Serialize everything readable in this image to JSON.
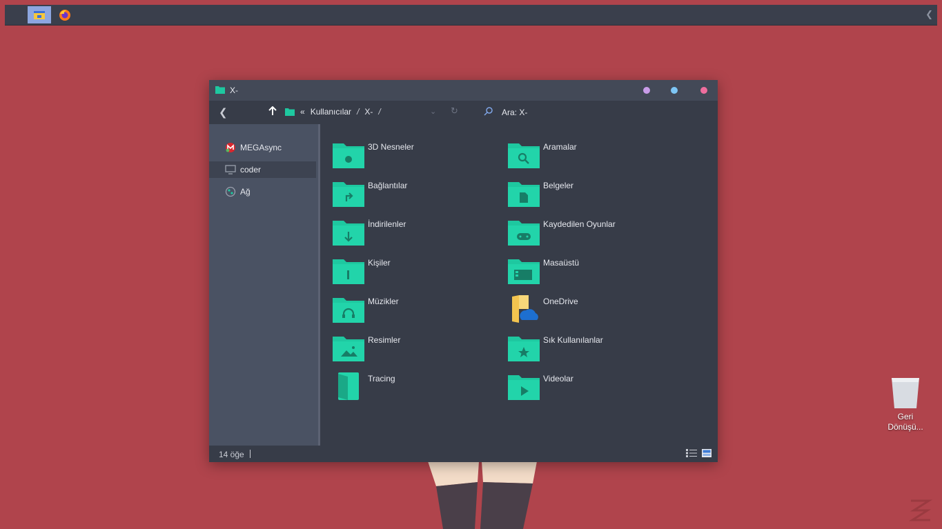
{
  "taskbar": {
    "apps": [
      {
        "name": "file-explorer",
        "icon": "folder-icon"
      },
      {
        "name": "firefox",
        "icon": "firefox-icon"
      }
    ],
    "overflow_icon": "chevron-left-icon"
  },
  "window": {
    "title": "X-",
    "controls": {
      "minimize": "#c99ce8",
      "maximize": "#7ec6f5",
      "close": "#ef6e9e"
    },
    "nav": {
      "back_icon": "chevron-left-icon",
      "up_icon": "arrow-up-icon",
      "breadcrumb_prefix": "«",
      "breadcrumbs": [
        "Kullanıcılar",
        "X-"
      ],
      "separator": "/",
      "search_placeholder": "Ara: X-"
    },
    "sidebar": {
      "items": [
        {
          "label": "MEGAsync",
          "icon": "megasync-icon",
          "selected": false
        },
        {
          "label": "coder",
          "icon": "monitor-icon",
          "selected": true
        },
        {
          "label": "Ağ",
          "icon": "network-icon",
          "selected": false
        }
      ]
    },
    "content": {
      "items": [
        {
          "label": "3D Nesneler",
          "icon": "3d-objects-folder-icon"
        },
        {
          "label": "Aramalar",
          "icon": "searches-folder-icon"
        },
        {
          "label": "Bağlantılar",
          "icon": "links-folder-icon"
        },
        {
          "label": "Belgeler",
          "icon": "documents-folder-icon"
        },
        {
          "label": "İndirilenler",
          "icon": "downloads-folder-icon"
        },
        {
          "label": "Kaydedilen Oyunlar",
          "icon": "saved-games-folder-icon"
        },
        {
          "label": "Kişiler",
          "icon": "contacts-folder-icon"
        },
        {
          "label": "Masaüstü",
          "icon": "desktop-folder-icon"
        },
        {
          "label": "Müzikler",
          "icon": "music-folder-icon"
        },
        {
          "label": "OneDrive",
          "icon": "onedrive-folder-icon"
        },
        {
          "label": "Resimler",
          "icon": "pictures-folder-icon"
        },
        {
          "label": "Sık Kullanılanlar",
          "icon": "favorites-folder-icon"
        },
        {
          "label": "Tracing",
          "icon": "tracing-folder-icon"
        },
        {
          "label": "Videolar",
          "icon": "videos-folder-icon"
        }
      ]
    },
    "status": {
      "item_count": "14 öğe",
      "view_icons": [
        "details-view-icon",
        "large-icons-view-icon"
      ]
    }
  },
  "desktop": {
    "recycle_bin_label": "Geri Dönüşü...",
    "colors": {
      "background": "#b0444c",
      "folder": "#1ec8a0",
      "window": "#373c48"
    }
  }
}
